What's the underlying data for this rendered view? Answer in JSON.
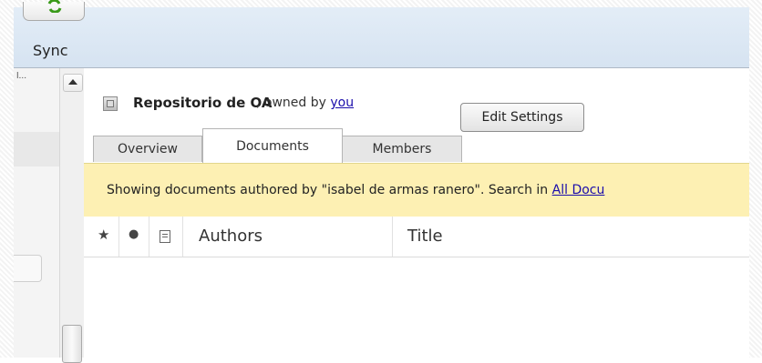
{
  "toolbar": {
    "sync_label": "Sync",
    "sync_icon": "refresh-icon"
  },
  "sidebar": {
    "truncated_text": "l..."
  },
  "group": {
    "name": "Repositorio de OA",
    "owned_prefix": ", owned by ",
    "owner_link": "you",
    "edit_settings_label": "Edit Settings"
  },
  "tabs": [
    {
      "label": "Overview",
      "active": false
    },
    {
      "label": "Documents",
      "active": true
    },
    {
      "label": "Members",
      "active": false
    }
  ],
  "notice": {
    "text": "Showing documents authored by \"isabel de armas ranero\". Search in ",
    "link": "All Docu"
  },
  "grid": {
    "columns": [
      "Authors",
      "Title"
    ],
    "icons": [
      "star-icon",
      "unread-dot-icon",
      "document-type-icon"
    ]
  },
  "colors": {
    "notice_bg": "#fdf0b3",
    "toolbar_bg": "#dbe7f3",
    "link": "#1a0dab",
    "sync_green": "#3a9a1a"
  }
}
